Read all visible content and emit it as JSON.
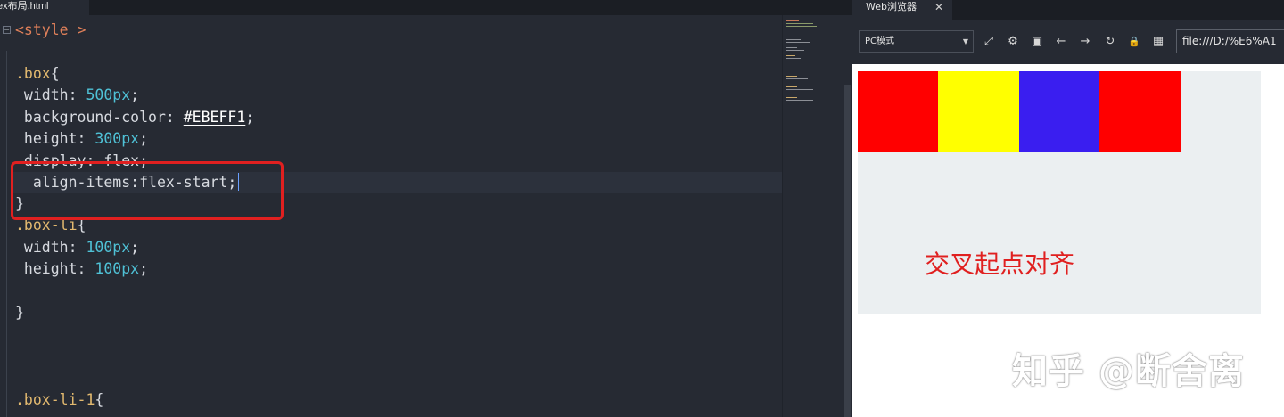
{
  "editor": {
    "tab_label": "ex布局.html",
    "fold_symbol": "⊟",
    "lines": {
      "l1": {
        "a": "<style",
        "b": " >"
      },
      "l3": {
        "a": ".box",
        "b": "{"
      },
      "l4": {
        "a": " width: ",
        "b": "500px",
        "c": ";"
      },
      "l5": {
        "a": " background-color: ",
        "b": "#EBEFF1",
        "c": ";"
      },
      "l6": {
        "a": " height: ",
        "b": "300px",
        "c": ";"
      },
      "l7": {
        "a": " display: flex;"
      },
      "l8": {
        "a": "  align-items:flex-start;"
      },
      "l9": {
        "a": "}"
      },
      "l10": {
        "a": ".box-li",
        "b": "{"
      },
      "l11": {
        "a": " width: ",
        "b": "100px",
        "c": ";"
      },
      "l12": {
        "a": " height: ",
        "b": "100px",
        "c": ";"
      },
      "l14": {
        "a": "}"
      },
      "l18": {
        "a": ".box-li-1",
        "b": "{"
      }
    }
  },
  "browser": {
    "tab_label": "Web浏览器",
    "tab_close": "✕",
    "mode_value": "PC模式",
    "address": "file:///D:/%E6%A1",
    "icons": [
      "screenshot-icon",
      "settings-icon",
      "console-icon",
      "back-icon",
      "forward-icon",
      "reload-icon",
      "lock-icon",
      "qrcode-icon"
    ],
    "icon_glyphs": [
      "⤢",
      "⚙",
      "▣",
      "←",
      "→",
      "↻",
      "🔒",
      "▦"
    ],
    "box_color": "#EBEFF1",
    "items": [
      {
        "color": "#FF0000"
      },
      {
        "color": "#FFFF00"
      },
      {
        "color": "#3A1EF0"
      },
      {
        "color": "#FF0000"
      }
    ],
    "caption": "交叉起点对齐"
  },
  "watermark": "知乎 @断舍离"
}
